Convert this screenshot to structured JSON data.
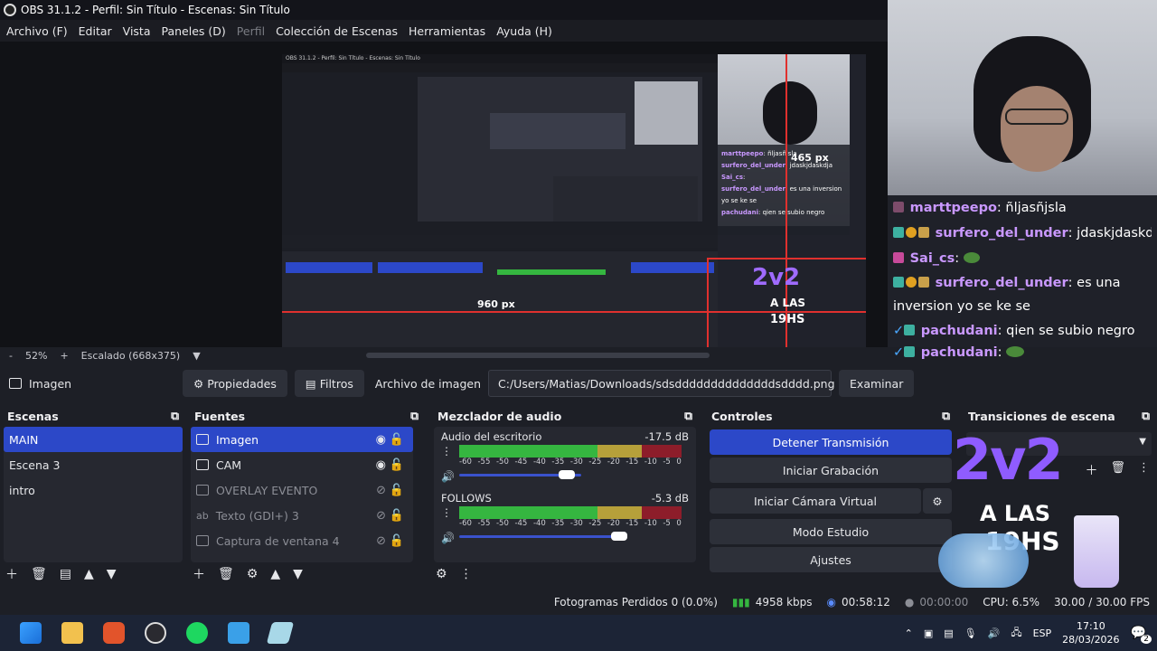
{
  "titlebar": {
    "title": "OBS 31.1.2 - Perfil: Sin Título - Escenas: Sin Título"
  },
  "menu": {
    "items": [
      "Archivo (F)",
      "Editar",
      "Vista",
      "Paneles (D)",
      "Perfil",
      "Colección de Escenas",
      "Herramientas",
      "Ayuda (H)"
    ]
  },
  "preview": {
    "measure_h": "465 px",
    "measure_w": "960 px",
    "nested_title": "OBS 31.1.2 - Perfil: Sin Título - Escenas: Sin Título"
  },
  "chat": {
    "messages": [
      {
        "user": "marttpeepo",
        "text": "ñljasñjsla"
      },
      {
        "user": "surfero_del_under",
        "text": "jdaskjdaskdja"
      },
      {
        "user": "Sai_cs",
        "text": ""
      },
      {
        "user": "surfero_del_under",
        "text": "es una inversion yo se ke se"
      },
      {
        "user": "pachudani",
        "text": "qien se subio negro"
      },
      {
        "user": "pachudani",
        "text": ""
      }
    ]
  },
  "zoombar": {
    "minus": "-",
    "zoom": "52%",
    "plus": "+",
    "scale": "Escalado (668x375)"
  },
  "propbar": {
    "source_name": "Imagen",
    "properties": "Propiedades",
    "filters": "Filtros",
    "file_label": "Archivo de imagen",
    "file_path": "C:/Users/Matias/Downloads/sdsddddddddddddddsdddd.png",
    "browse": "Examinar"
  },
  "scenes": {
    "title": "Escenas",
    "items": [
      "MAIN",
      "Escena 3",
      "intro"
    ]
  },
  "sources": {
    "title": "Fuentes",
    "items": [
      "Imagen",
      "CAM",
      "OVERLAY EVENTO",
      "Texto (GDI+) 3",
      "Captura de ventana 4"
    ]
  },
  "mixer": {
    "title": "Mezclador de audio",
    "channels": [
      {
        "name": "Audio del escritorio",
        "db": "-17.5 dB",
        "volume": 0.82
      },
      {
        "name": "FOLLOWS",
        "db": "-5.3 dB",
        "volume": 0.9
      }
    ],
    "ticks": [
      "-60",
      "-55",
      "-50",
      "-45",
      "-40",
      "-35",
      "-30",
      "-25",
      "-20",
      "-15",
      "-10",
      "-5",
      "0"
    ]
  },
  "controls": {
    "title": "Controles",
    "stop_stream": "Detener Transmisión",
    "start_rec": "Iniciar Grabación",
    "start_vcam": "Iniciar Cámara Virtual",
    "studio": "Modo Estudio",
    "settings": "Ajustes"
  },
  "transitions": {
    "title": "Transiciones de escena"
  },
  "overlay": {
    "line1": "2v2",
    "line2": "A LAS",
    "line3": "19HS"
  },
  "status": {
    "dropped": "Fotogramas Perdidos 0 (0.0%)",
    "bitrate": "4958 kbps",
    "stream_time": "00:58:12",
    "rec_time": "00:00:00",
    "cpu": "CPU: 6.5%",
    "fps": "30.00 / 30.00 FPS"
  },
  "taskbar": {
    "lang": "ESP",
    "time": "17:10",
    "date": "28/03/2026",
    "notif": "2"
  },
  "colors": {
    "accent": "#2c48c8",
    "chat_user": "#c998ff",
    "live": "#35b640"
  }
}
